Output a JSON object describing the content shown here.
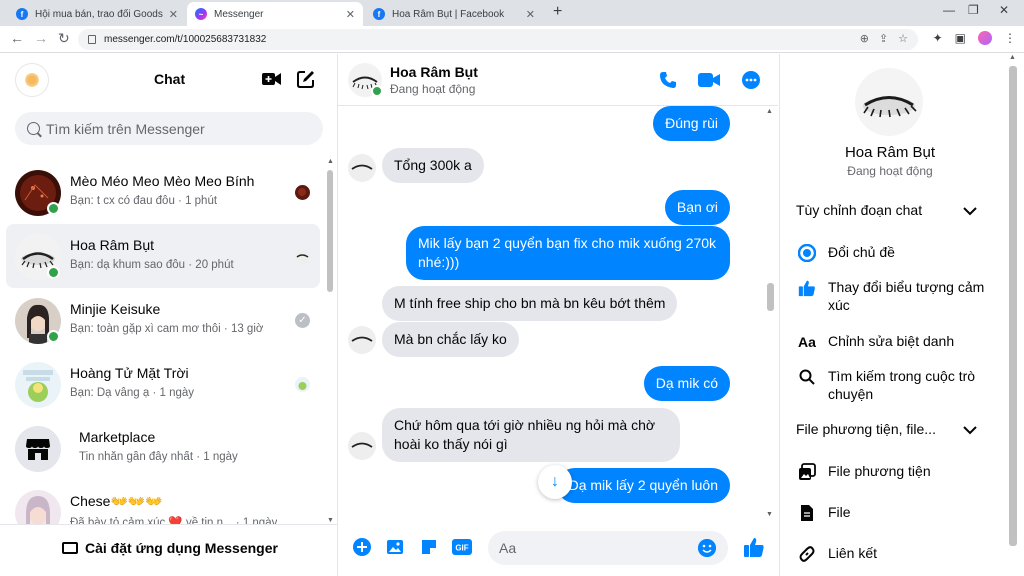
{
  "browser": {
    "tabs": [
      {
        "title": "Hội mua bán, trao đổi Goods An"
      },
      {
        "title": "Messenger"
      },
      {
        "title": "Hoa Râm Bụt | Facebook"
      }
    ],
    "url": "messenger.com/t/100025683731832"
  },
  "sidebar": {
    "title": "Chat",
    "search_placeholder": "Tìm kiếm trên Messenger",
    "conversations": [
      {
        "name": "Mèo Méo Meo Mèo Meo Bính",
        "preview": "Bạn: t cx có đau đôu · 1 phút",
        "online": true
      },
      {
        "name": "Hoa Râm Bụt",
        "preview": "Bạn: dạ khum sao đôu · 20 phút",
        "online": true,
        "selected": true
      },
      {
        "name": "Minjie Keisuke",
        "preview": "Bạn: toàn gặp xì cam mơ thôi · 13 giờ",
        "online": true
      },
      {
        "name": "Hoàng Tử Mặt Trời",
        "preview": "Bạn: Dạ vâng ạ · 1 ngày",
        "online": false
      },
      {
        "name": "Marketplace",
        "preview": "Tin nhắn gần đây nhất · 1 ngày",
        "online": false
      },
      {
        "name": "Chese👐👐👐",
        "preview": "Đã bày tỏ cảm xúc ❤️ về tin n... · 1 ngày",
        "online": false
      }
    ],
    "install_label": "Cài đặt ứng dụng Messenger"
  },
  "chat": {
    "contact_name": "Hoa Râm Bụt",
    "contact_status": "Đang hoạt động",
    "messages": [
      {
        "dir": "out",
        "text": "Đúng rùi"
      },
      {
        "dir": "in",
        "text": "Tổng 300k a"
      },
      {
        "dir": "out",
        "text": "Bạn ơi"
      },
      {
        "dir": "out",
        "text": "Mik lấy bạn 2 quyển bạn fix cho mik xuống 270k nhé:)))"
      },
      {
        "dir": "in",
        "text": "M tính free ship cho bn mà bn kêu bớt thêm"
      },
      {
        "dir": "in",
        "text": "Mà bn chắc lấy ko"
      },
      {
        "dir": "out",
        "text": "Dạ mik có"
      },
      {
        "dir": "in",
        "text": "Chứ hôm qua tới giờ nhiều ng hỏi mà chờ hoài ko thấy nói gì"
      },
      {
        "dir": "out",
        "text": "Dạ mik lấy 2 quyển luôn"
      }
    ],
    "input_placeholder": "Aa"
  },
  "details": {
    "name": "Hoa Râm Bụt",
    "status": "Đang hoạt động",
    "section_customize": "Tùy chỉnh đoạn chat",
    "customize_items": [
      {
        "icon": "theme-icon",
        "label": "Đổi chủ đề"
      },
      {
        "icon": "thumbs-up-icon",
        "label": "Thay đổi biểu tượng cảm xúc"
      },
      {
        "icon": "nickname-icon",
        "label": "Chỉnh sửa biệt danh"
      },
      {
        "icon": "search-icon",
        "label": "Tìm kiếm trong cuộc trò chuyện"
      }
    ],
    "section_media": "File phương tiện, file...",
    "media_items": [
      {
        "icon": "media-icon",
        "label": "File phương tiện"
      },
      {
        "icon": "file-icon",
        "label": "File"
      },
      {
        "icon": "link-icon",
        "label": "Liên kết"
      }
    ]
  },
  "colors": {
    "accent": "#0084ff",
    "online": "#31a24c",
    "incoming_bubble": "#e4e6eb"
  }
}
